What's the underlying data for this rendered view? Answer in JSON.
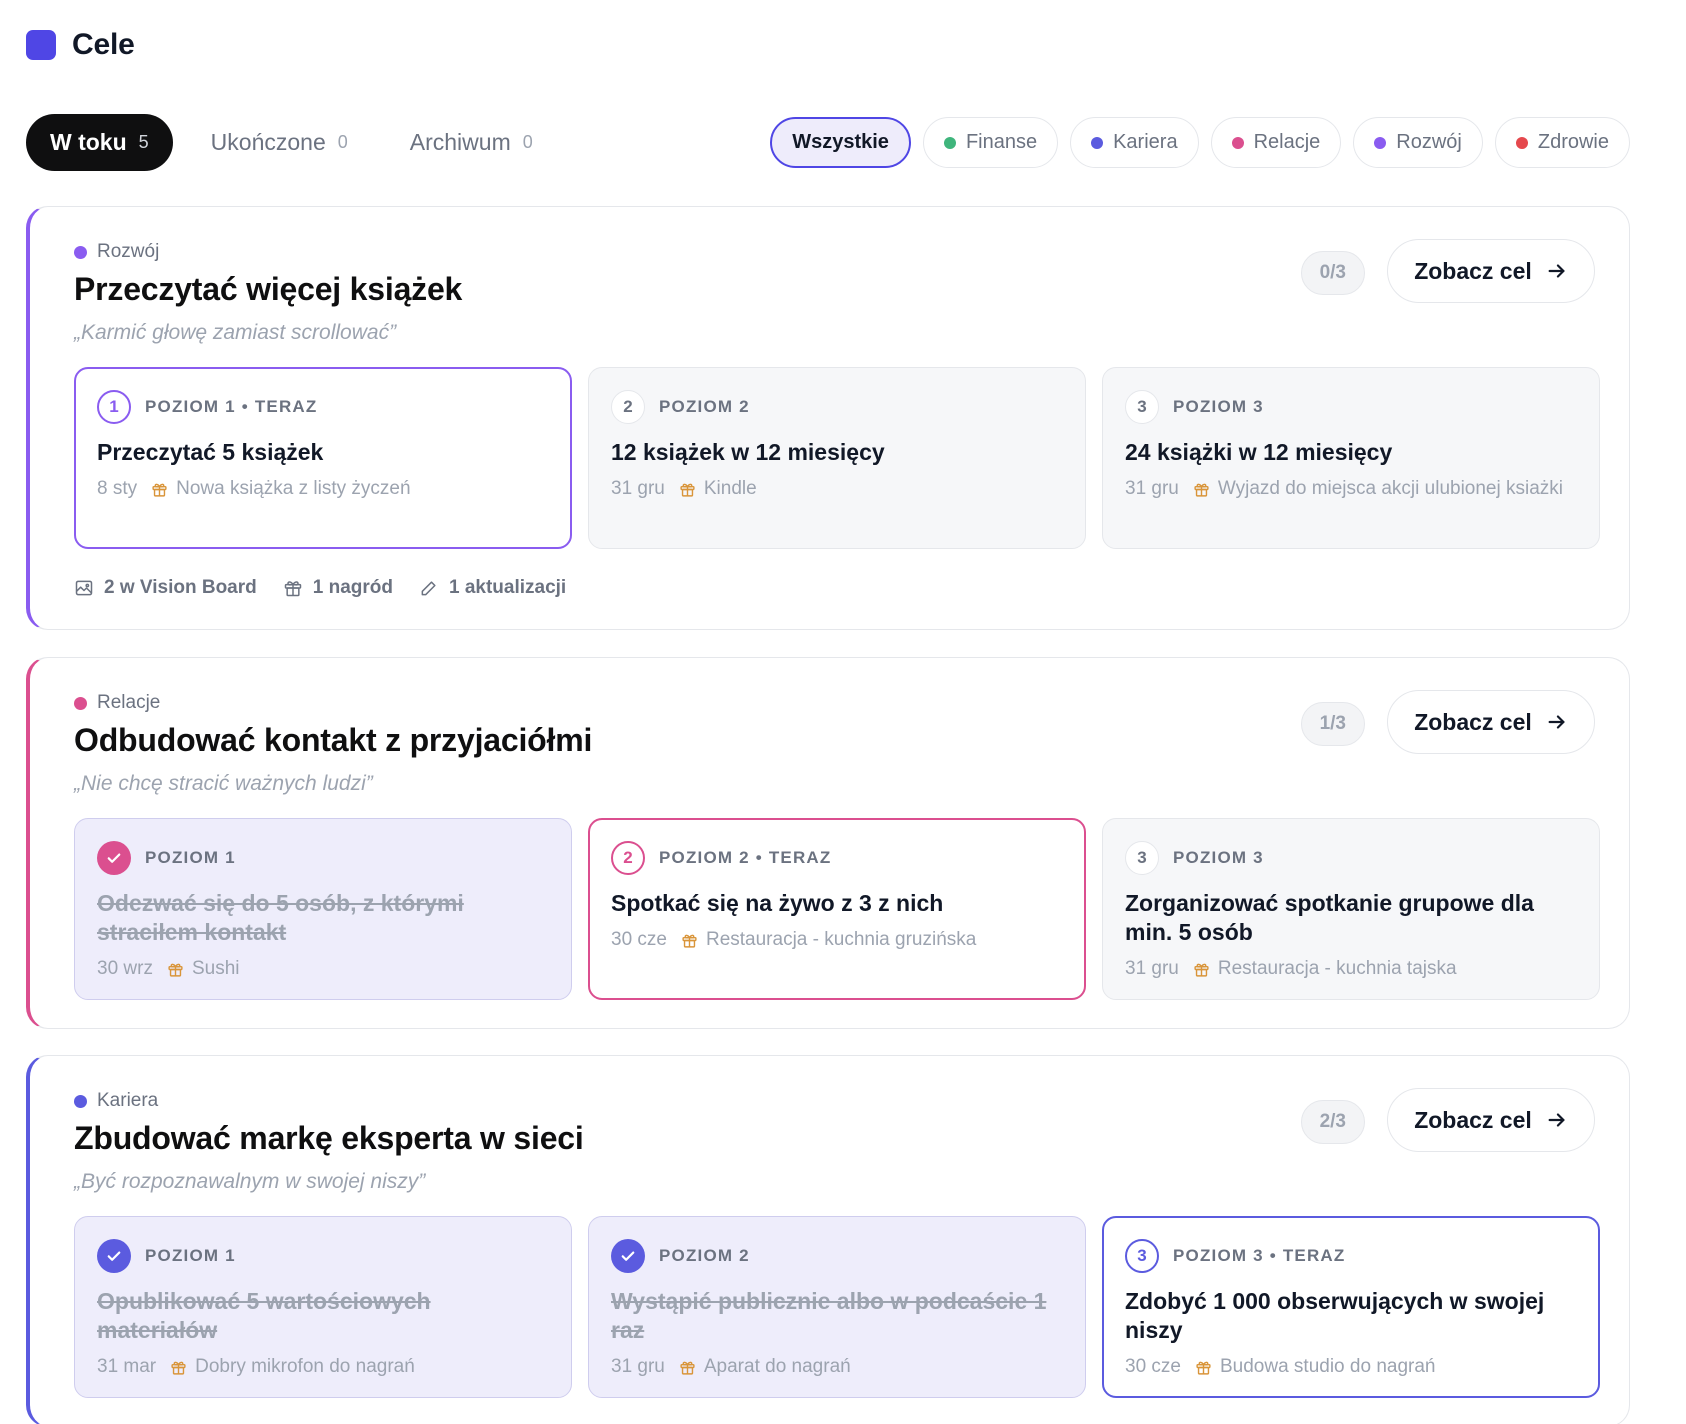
{
  "app": {
    "title": "Cele",
    "logo_color": "#4f46e5"
  },
  "tabs": [
    {
      "label": "W toku",
      "count": "5",
      "active": true
    },
    {
      "label": "Ukończone",
      "count": "0",
      "active": false
    },
    {
      "label": "Archiwum",
      "count": "0",
      "active": false
    }
  ],
  "filters": [
    {
      "label": "Wszystkie",
      "active": true,
      "color": ""
    },
    {
      "label": "Finanse",
      "color": "#3fb57c"
    },
    {
      "label": "Kariera",
      "color": "#5b5bdf"
    },
    {
      "label": "Relacje",
      "color": "#db4f8f"
    },
    {
      "label": "Rozwój",
      "color": "#8a5cf0"
    },
    {
      "label": "Zdrowie",
      "color": "#e5484d"
    }
  ],
  "view_button_label": "Zobacz cel",
  "goals": [
    {
      "category": "Rozwój",
      "accent": "#8a5cf0",
      "title": "Przeczytać więcej książek",
      "quote": "„Karmić głowę zamiast scrollować”",
      "progress": "0/3",
      "levels": [
        {
          "number": "1",
          "label": "POZIOM 1 • TERAZ",
          "state": "current",
          "title": "Przeczytać 5 książek",
          "date": "8 sty",
          "reward": "Nowa książka z listy życzeń"
        },
        {
          "number": "2",
          "label": "POZIOM 2",
          "state": "pending",
          "title": "12 książek w 12 miesięcy",
          "date": "31 gru",
          "reward": "Kindle"
        },
        {
          "number": "3",
          "label": "POZIOM 3",
          "state": "pending",
          "title": "24 książki w 12 miesięcy",
          "date": "31 gru",
          "reward": "Wyjazd do miejsca akcji ulubionej ksiażki"
        }
      ],
      "footer": {
        "vision": "2 w Vision Board",
        "rewards": "1 nagród",
        "updates": "1 aktualizacji"
      }
    },
    {
      "category": "Relacje",
      "accent": "#db4f8f",
      "title": "Odbudować kontakt z przyjaciółmi",
      "quote": "„Nie chcę stracić ważnych ludzi”",
      "progress": "1/3",
      "levels": [
        {
          "number": "1",
          "label": "POZIOM 1",
          "state": "done",
          "title": "Odezwać się do 5 osób, z którymi straciłem kontakt",
          "date": "30 wrz",
          "reward": "Sushi"
        },
        {
          "number": "2",
          "label": "POZIOM 2 • TERAZ",
          "state": "current",
          "title": "Spotkać się na żywo z 3 z nich",
          "date": "30 cze",
          "reward": "Restauracja - kuchnia gruzińska"
        },
        {
          "number": "3",
          "label": "POZIOM 3",
          "state": "pending",
          "title": "Zorganizować spotkanie grupowe dla min. 5 osób",
          "date": "31 gru",
          "reward": "Restauracja - kuchnia tajska"
        }
      ]
    },
    {
      "category": "Kariera",
      "accent": "#5b5bdf",
      "title": "Zbudować markę eksperta w sieci",
      "quote": "„Być rozpoznawalnym w swojej niszy”",
      "progress": "2/3",
      "levels": [
        {
          "number": "1",
          "label": "POZIOM 1",
          "state": "done",
          "title": "Opublikować 5 wartościowych materiałów",
          "date": "31 mar",
          "reward": "Dobry mikrofon do nagrań"
        },
        {
          "number": "2",
          "label": "POZIOM 2",
          "state": "done",
          "title": "Wystąpić publicznie albo w podcaście 1 raz",
          "date": "31 gru",
          "reward": "Aparat do nagrań"
        },
        {
          "number": "3",
          "label": "POZIOM 3 • TERAZ",
          "state": "current",
          "title": "Zdobyć 1 000 obserwujących w swojej niszy",
          "date": "30 cze",
          "reward": "Budowa studio do nagrań"
        }
      ]
    }
  ]
}
